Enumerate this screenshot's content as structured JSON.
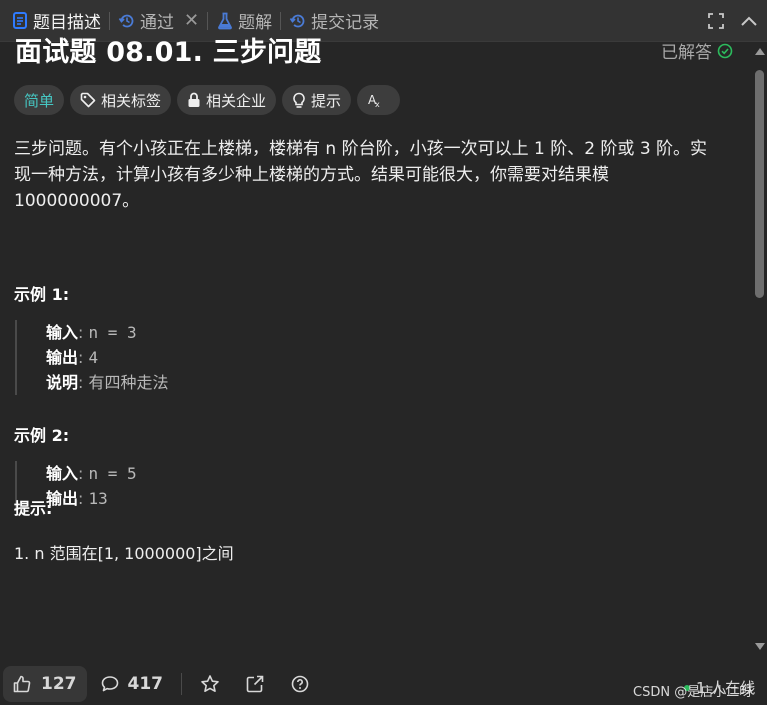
{
  "tabs": {
    "description": "题目描述",
    "accepted": "通过",
    "solutions": "题解",
    "submissions": "提交记录"
  },
  "problem": {
    "title": "面试题 08.01. 三步问题",
    "solved_label": "已解答",
    "difficulty": "简单",
    "tag_labels": [
      "相关标签",
      "相关企业",
      "提示"
    ],
    "translate_glyph": "Aあ",
    "description_lines": [
      "三步问题。有个小孩正在上楼梯，楼梯有 n 阶台阶，小孩一次可以上 1 阶、2 阶或 3 阶。实",
      "现一种方法，计算小孩有多少种上楼梯的方式。结果可能很大，你需要对结果模",
      "1000000007。"
    ]
  },
  "examples": [
    {
      "title": "示例 1:",
      "input_label": "输入",
      "input": "n = 3",
      "output_label": "输出",
      "output": "4",
      "explain_label": "说明",
      "explain": "有四种走法"
    },
    {
      "title": "示例 2:",
      "input_label": "输入",
      "input": "n = 5",
      "output_label": "输出",
      "output": "13"
    }
  ],
  "hints": {
    "title": "提示:",
    "items": [
      "1. n 范围在[1, 1000000]之间"
    ]
  },
  "footer": {
    "likes": "127",
    "comments": "417",
    "online": "1 人在线",
    "watermark": "CSDN @是店小二呀"
  },
  "icons": {
    "description": "document-icon",
    "accepted": "history-icon",
    "solutions": "flask-icon",
    "submissions": "history-icon",
    "close": "close-icon",
    "fullscreen": "fullscreen-icon",
    "collapse": "chevron-up-icon",
    "solved": "check-circle-icon",
    "tag": "tag-icon",
    "company": "lock-icon",
    "hint": "lightbulb-icon",
    "translate": "translate-icon",
    "like": "thumb-up-icon",
    "comment": "comment-icon",
    "favorite": "star-icon",
    "share": "share-icon",
    "help": "question-icon"
  },
  "colors": {
    "accent_blue": "#2f7bff",
    "difficulty_easy": "#46c6c2",
    "solved_green": "#2cbb5d",
    "background": "#262626"
  }
}
